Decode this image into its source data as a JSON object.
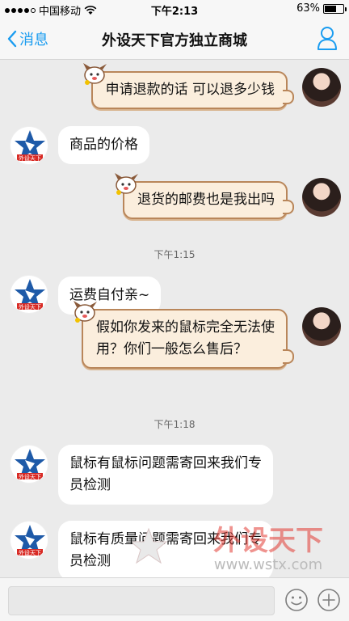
{
  "status": {
    "carrier": "中国移动",
    "time": "下午2:13",
    "battery": "63%",
    "battery_level": 0.63
  },
  "nav": {
    "back_label": "消息",
    "title": "外设天下官方独立商城"
  },
  "messages": [
    {
      "side": "right",
      "lines": [
        "申请退款的话 可以退多少钱"
      ]
    },
    {
      "side": "left",
      "lines": [
        "商品的价格"
      ]
    },
    {
      "side": "right",
      "lines": [
        "退货的邮费也是我出吗"
      ]
    },
    {
      "side": "time",
      "text": "下午1:15"
    },
    {
      "side": "left",
      "lines": [
        "运费自付亲~"
      ]
    },
    {
      "side": "right",
      "lines": [
        "假如你发来的鼠标完全无法使",
        "用？你们一般怎么售后？"
      ]
    },
    {
      "side": "time",
      "text": "下午1:18"
    },
    {
      "side": "left",
      "lines": [
        "鼠标有鼠标问题需寄回来我们专",
        "员检测"
      ]
    },
    {
      "side": "left",
      "lines": [
        "鼠标有质量问题需寄回来我们专",
        "员检测"
      ]
    }
  ],
  "shop_avatar_text": "外设天下",
  "watermark": {
    "brand": "外设天下",
    "url": "www.wstx.com"
  },
  "colors": {
    "accent": "#1a9cf0",
    "bubble_right_bg": "#fbeedd",
    "bubble_right_border": "#b9865a",
    "watermark_red": "#e23b33"
  },
  "icons": {
    "back": "chevron-left-icon",
    "profile": "person-icon",
    "emoji": "smiley-icon",
    "more": "plus-circle-icon"
  }
}
